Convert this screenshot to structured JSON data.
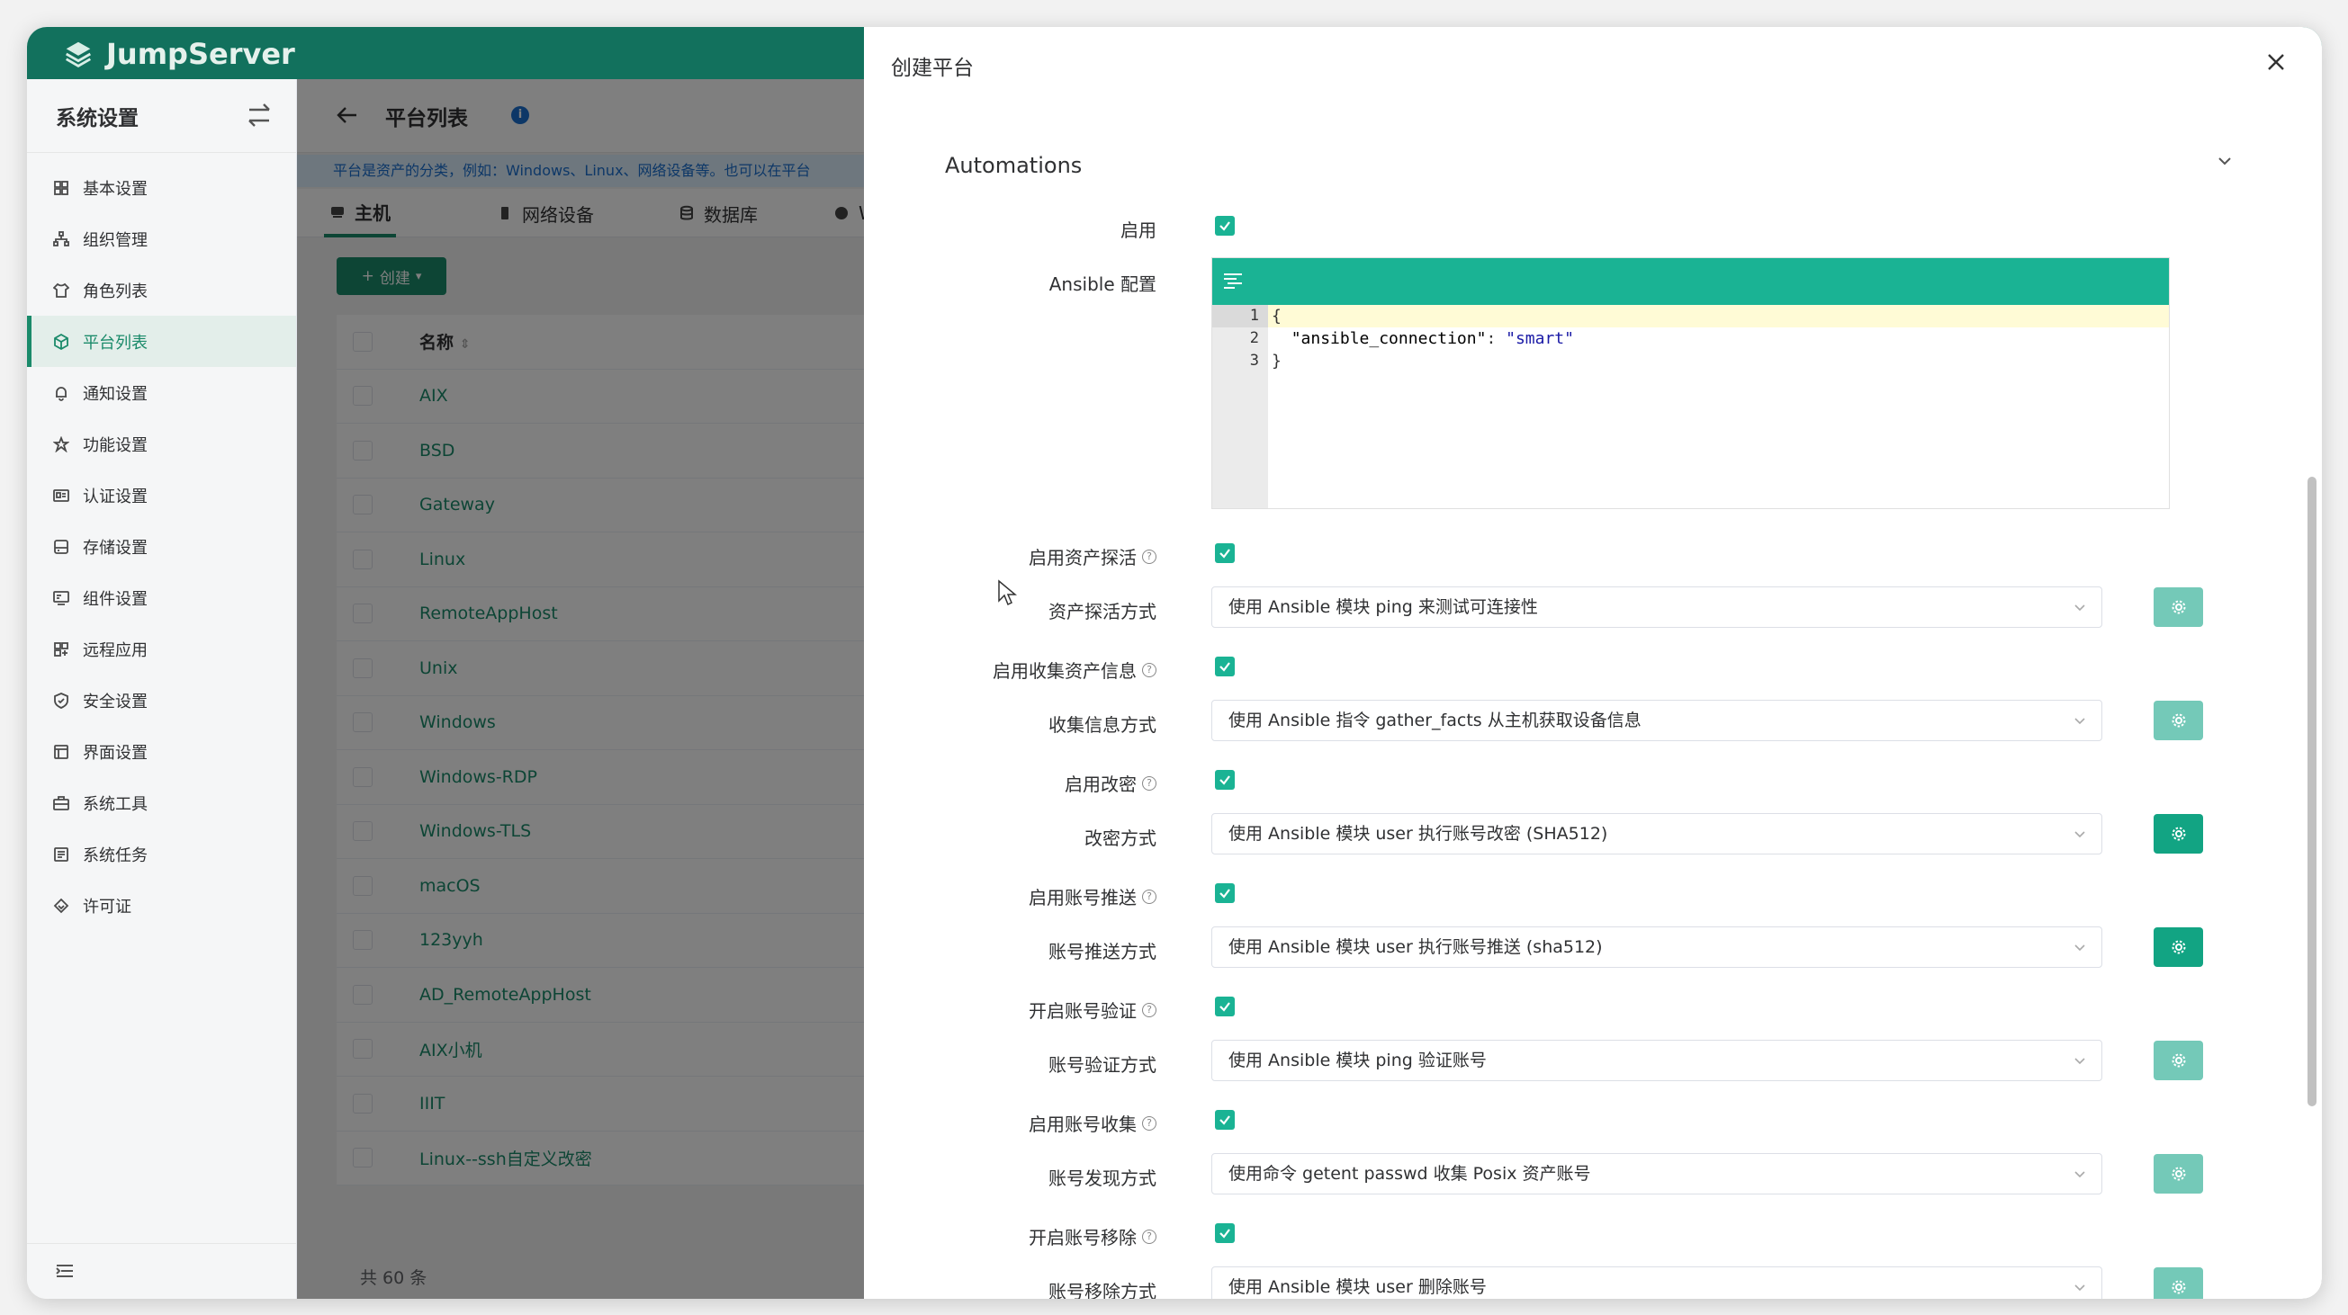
{
  "app": {
    "brand": "JumpServer"
  },
  "sidebar": {
    "title": "系统设置",
    "items": [
      {
        "label": "基本设置",
        "icon": "grid-icon"
      },
      {
        "label": "组织管理",
        "icon": "org-icon"
      },
      {
        "label": "角色列表",
        "icon": "shirt-icon"
      },
      {
        "label": "平台列表",
        "icon": "cube-icon",
        "active": true
      },
      {
        "label": "通知设置",
        "icon": "bell-icon"
      },
      {
        "label": "功能设置",
        "icon": "star-icon"
      },
      {
        "label": "认证设置",
        "icon": "id-card-icon"
      },
      {
        "label": "存储设置",
        "icon": "storage-icon"
      },
      {
        "label": "组件设置",
        "icon": "component-icon"
      },
      {
        "label": "远程应用",
        "icon": "apps-icon"
      },
      {
        "label": "安全设置",
        "icon": "shield-icon"
      },
      {
        "label": "界面设置",
        "icon": "interface-icon"
      },
      {
        "label": "系统工具",
        "icon": "toolbox-icon"
      },
      {
        "label": "系统任务",
        "icon": "task-icon"
      },
      {
        "label": "许可证",
        "icon": "license-icon"
      }
    ]
  },
  "page": {
    "title": "平台列表",
    "notice": "平台是资产的分类，例如：Windows、Linux、网络设备等。也可以在平台",
    "tabs": [
      {
        "label": "主机",
        "active": true
      },
      {
        "label": "网络设备"
      },
      {
        "label": "数据库"
      },
      {
        "label": "We"
      }
    ],
    "create_label": "创建",
    "table": {
      "header": "名称",
      "rows": [
        "AIX",
        "BSD",
        "Gateway",
        "Linux",
        "RemoteAppHost",
        "Unix",
        "Windows",
        "Windows-RDP",
        "Windows-TLS",
        "macOS",
        "123yyh",
        "AD_RemoteAppHost",
        "AIX小机",
        "IIIT",
        "Linux--ssh自定义改密"
      ]
    },
    "total": "共 60 条"
  },
  "drawer": {
    "title": "创建平台",
    "section_title": "Automations",
    "enable_label": "启用",
    "ansible_label": "Ansible 配置",
    "editor": {
      "line_numbers": [
        "1",
        "2",
        "3"
      ],
      "line1": "{",
      "line2_key": "\"ansible_connection\"",
      "line2_sep": ": ",
      "line2_val": "\"smart\"",
      "line3": "}"
    },
    "rows": [
      {
        "toggle_label": "启用资产探活",
        "method_label": "资产探活方式",
        "method_value": "使用 Ansible 模块 ping 来测试可连接性",
        "btn_style": "light"
      },
      {
        "toggle_label": "启用收集资产信息",
        "method_label": "收集信息方式",
        "method_value": "使用 Ansible 指令 gather_facts 从主机获取设备信息",
        "btn_style": "light"
      },
      {
        "toggle_label": "启用改密",
        "method_label": "改密方式",
        "method_value": "使用 Ansible 模块 user 执行账号改密 (SHA512)",
        "btn_style": "dark"
      },
      {
        "toggle_label": "启用账号推送",
        "method_label": "账号推送方式",
        "method_value": "使用 Ansible 模块 user 执行账号推送 (sha512)",
        "btn_style": "dark"
      },
      {
        "toggle_label": "开启账号验证",
        "method_label": "账号验证方式",
        "method_value": "使用 Ansible 模块 ping 验证账号",
        "btn_style": "light"
      },
      {
        "toggle_label": "启用账号收集",
        "method_label": "账号发现方式",
        "method_value": "使用命令 getent passwd 收集 Posix 资产账号",
        "btn_style": "light"
      },
      {
        "toggle_label": "开启账号移除",
        "method_label": "账号移除方式",
        "method_value": "使用 Ansible 模块 user 删除账号",
        "btn_style": "light"
      }
    ]
  },
  "colors": {
    "brand": "#12715d",
    "accent": "#1ab394",
    "link": "#1a8a6a"
  }
}
